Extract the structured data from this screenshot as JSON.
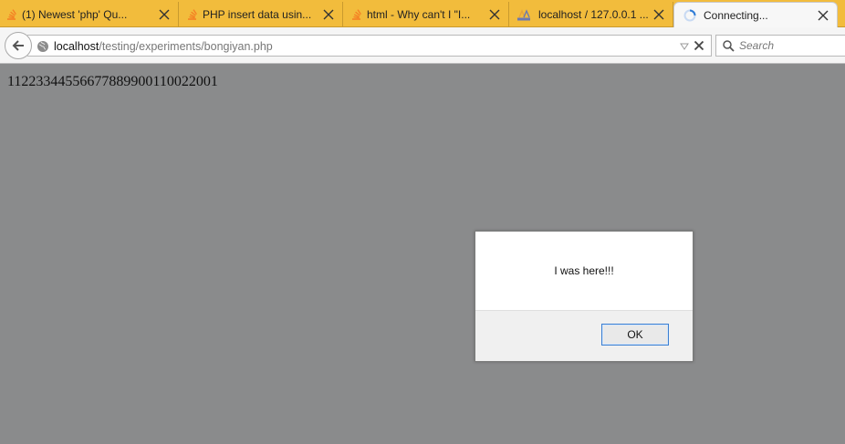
{
  "tabs": [
    {
      "title": "(1) Newest 'php' Qu...",
      "favicon": "stackoverflow-icon"
    },
    {
      "title": "PHP insert data usin...",
      "favicon": "stackoverflow-icon"
    },
    {
      "title": "html - Why can't I \"I...",
      "favicon": "stackoverflow-icon"
    },
    {
      "title": "localhost / 127.0.0.1 ...",
      "favicon": "phpmyadmin-icon"
    },
    {
      "title": "Connecting...",
      "favicon": "loading-spinner-icon"
    }
  ],
  "address": {
    "host": "localhost",
    "path": "/testing/experiments/bongiyan.php"
  },
  "search": {
    "placeholder": "Search"
  },
  "page": {
    "text": "11223344556677889900110022001"
  },
  "dialog": {
    "message": "I was here!!!",
    "ok_label": "OK"
  },
  "colors": {
    "tabstrip": "#f2bc3c",
    "content_overlay": "#8a8b8c",
    "focus_blue": "#3c7fd1"
  }
}
